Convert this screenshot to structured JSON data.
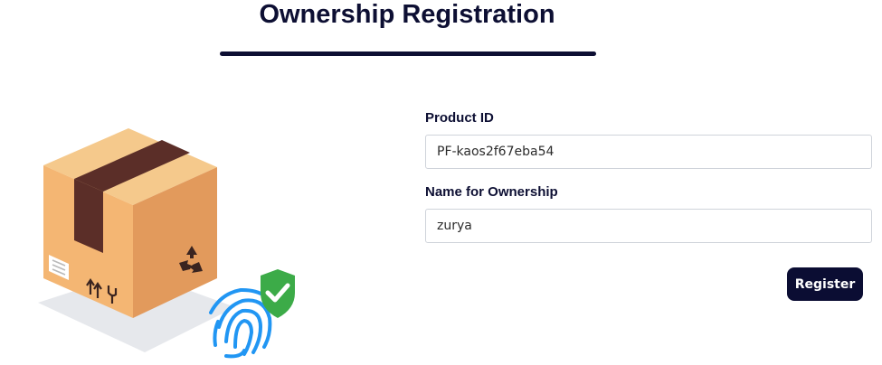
{
  "page": {
    "title": "Ownership Registration"
  },
  "form": {
    "product_id": {
      "label": "Product ID",
      "value": "PF-kaos2f67eba54"
    },
    "owner_name": {
      "label": "Name for Ownership",
      "value": "zurya"
    },
    "register_label": "Register"
  },
  "illustration": {
    "icons": [
      "package-box-icon",
      "recycle-icon",
      "this-way-up-icon",
      "fragile-glass-icon",
      "fingerprint-icon",
      "shield-check-icon"
    ]
  },
  "colors": {
    "primary": "#0b0d33",
    "box_front": "#e59f63",
    "box_top": "#f6c98a",
    "tape": "#5a2e27",
    "fingerprint": "#2196f3",
    "shield": "#3cab48"
  }
}
